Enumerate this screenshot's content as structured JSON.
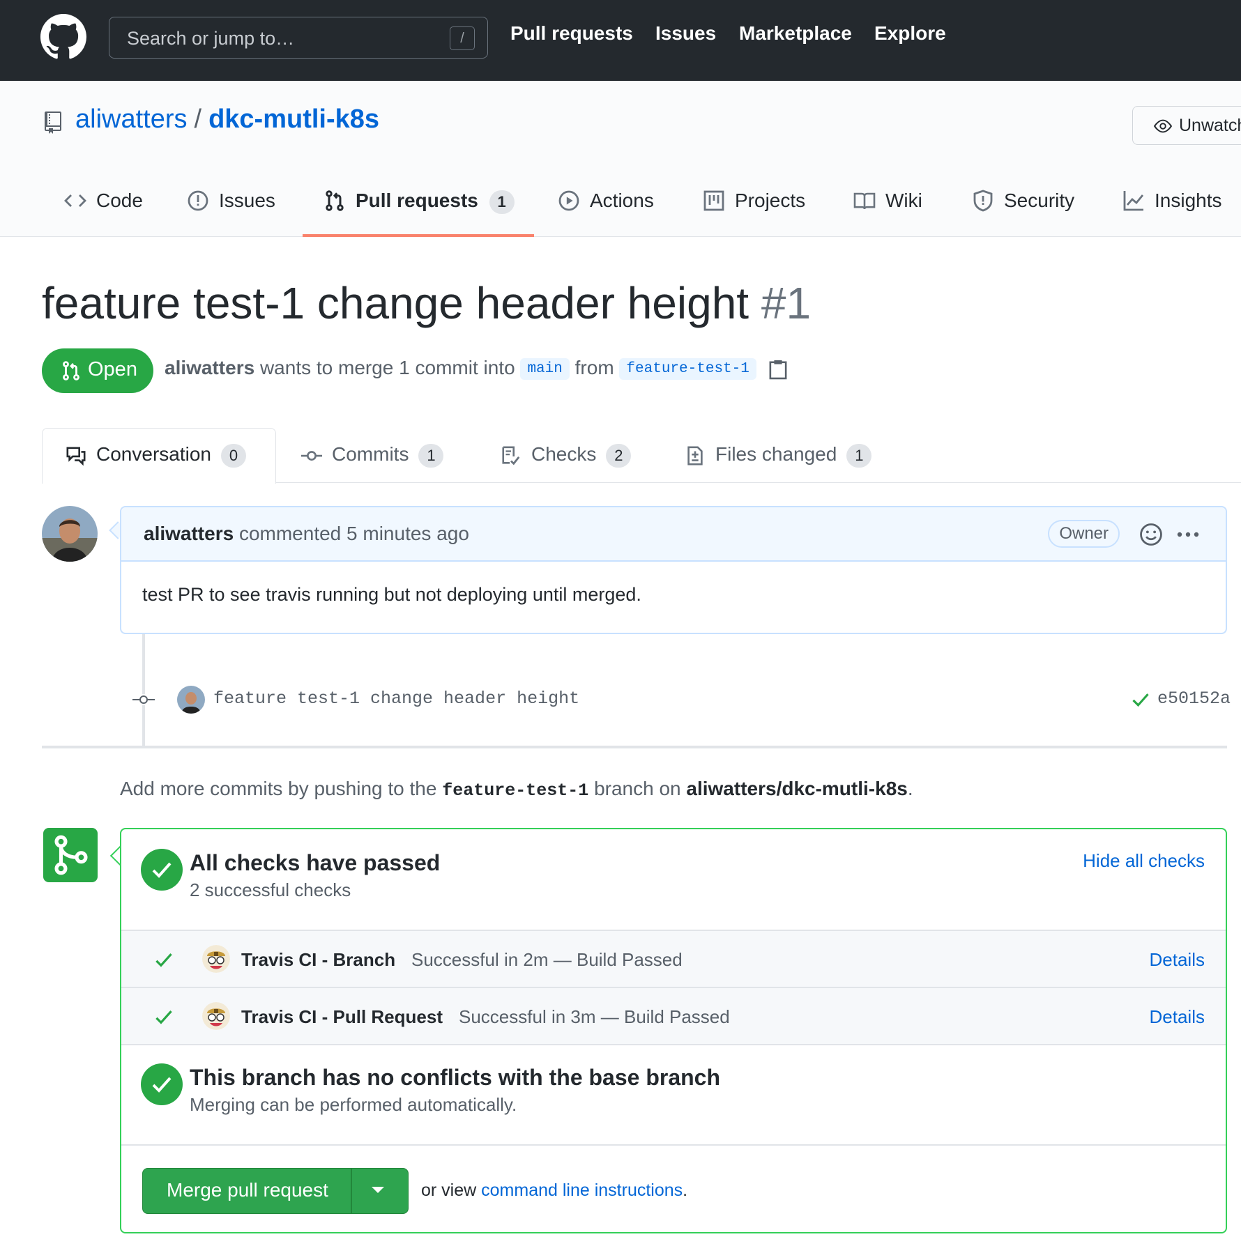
{
  "header": {
    "search_placeholder": "Search or jump to…",
    "search_key": "/",
    "nav": [
      "Pull requests",
      "Issues",
      "Marketplace",
      "Explore"
    ]
  },
  "repo": {
    "owner": "aliwatters",
    "separator": "/",
    "name": "dkc-mutli-k8s",
    "watch_label": "Unwatch",
    "tabs": [
      {
        "label": "Code",
        "icon": "code-icon"
      },
      {
        "label": "Issues",
        "icon": "issue-icon"
      },
      {
        "label": "Pull requests",
        "icon": "git-pull-request-icon",
        "count": "1",
        "active": true
      },
      {
        "label": "Actions",
        "icon": "play-icon"
      },
      {
        "label": "Projects",
        "icon": "project-icon"
      },
      {
        "label": "Wiki",
        "icon": "book-icon"
      },
      {
        "label": "Security",
        "icon": "shield-icon"
      },
      {
        "label": "Insights",
        "icon": "graph-icon"
      }
    ]
  },
  "pr": {
    "title": "feature test-1 change header height",
    "number": "#1",
    "state": "Open",
    "author": "aliwatters",
    "meta_text": "wants to merge 1 commit into",
    "base_branch": "main",
    "from_text": "from",
    "head_branch": "feature-test-1",
    "tabs": [
      {
        "label": "Conversation",
        "count": "0",
        "icon": "comment-discussion-icon"
      },
      {
        "label": "Commits",
        "count": "1",
        "icon": "git-commit-icon"
      },
      {
        "label": "Checks",
        "count": "2",
        "icon": "checklist-icon"
      },
      {
        "label": "Files changed",
        "count": "1",
        "icon": "diff-icon"
      }
    ]
  },
  "comment": {
    "author": "aliwatters",
    "action": "commented 5 minutes ago",
    "badge": "Owner",
    "body": "test PR to see travis running but not deploying until merged."
  },
  "commit": {
    "message": "feature test-1 change header height",
    "sha": "e50152a"
  },
  "push_hint": {
    "prefix": "Add more commits by pushing to the",
    "branch": "feature-test-1",
    "middle": "branch on",
    "repo": "aliwatters/dkc-mutli-k8s",
    "suffix": "."
  },
  "merge": {
    "checks_title": "All checks have passed",
    "checks_sub": "2 successful checks",
    "hide_link": "Hide all checks",
    "checks": [
      {
        "name": "Travis CI - Branch",
        "desc": "Successful in 2m — Build Passed",
        "link": "Details"
      },
      {
        "name": "Travis CI - Pull Request",
        "desc": "Successful in 3m — Build Passed",
        "link": "Details"
      }
    ],
    "conflict_title": "This branch has no conflicts with the base branch",
    "conflict_sub": "Merging can be performed automatically.",
    "button_label": "Merge pull request",
    "alt_prefix": "or view",
    "alt_link": "command line instructions",
    "alt_suffix": "."
  },
  "colors": {
    "header_bg": "#24292e",
    "link": "#0366d6",
    "success": "#28a745",
    "tab_underline": "#f9826c"
  }
}
